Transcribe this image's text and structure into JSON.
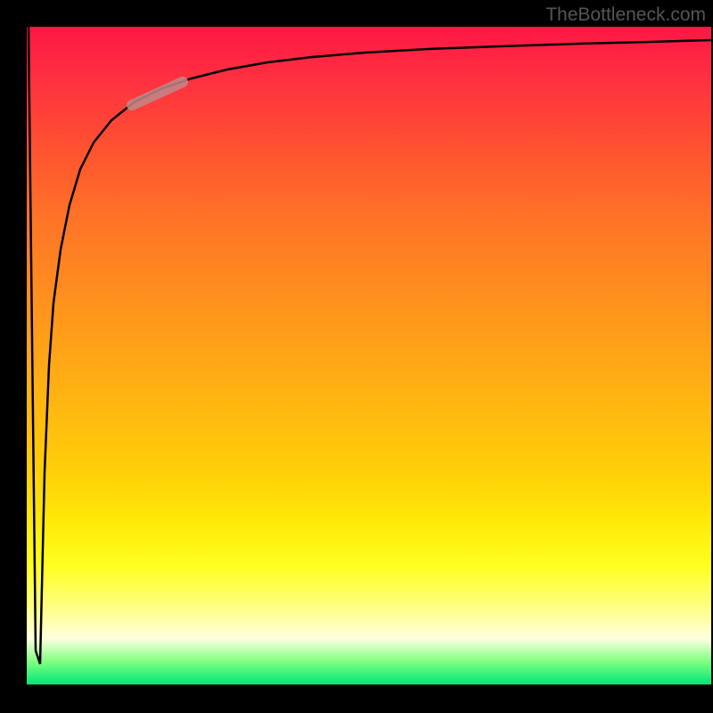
{
  "attribution": "TheBottleneck.com",
  "chart_data": {
    "type": "line",
    "title": "",
    "xlabel": "",
    "ylabel": "",
    "xlim": [
      0,
      100
    ],
    "ylim": [
      0,
      100
    ],
    "x": [
      0,
      1,
      2,
      3,
      4,
      5,
      6,
      8,
      10,
      12,
      15,
      18,
      22,
      26,
      30,
      35,
      40,
      50,
      60,
      70,
      80,
      90,
      100
    ],
    "values": [
      100,
      50,
      5,
      30,
      50,
      62,
      70,
      78,
      83,
      86,
      89,
      91,
      92.5,
      93.5,
      94.3,
      95,
      95.5,
      96.3,
      96.8,
      97.2,
      97.5,
      97.7,
      97.9
    ],
    "highlight_region": {
      "x_start": 15,
      "x_end": 22
    },
    "background_gradient": {
      "top": "#ff1744",
      "middle": "#ffff20",
      "bottom": "#00e676"
    }
  }
}
